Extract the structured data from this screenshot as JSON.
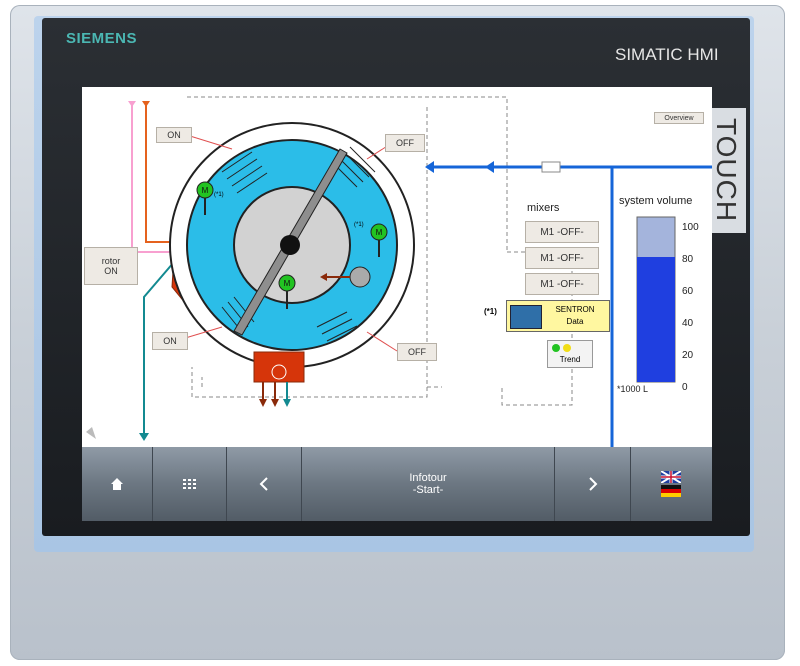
{
  "device": {
    "brand": "SIEMENS",
    "model": "SIMATIC HMI",
    "side_label": "TOUCH"
  },
  "screen": {
    "overview_button": "Overview",
    "labels": {
      "on_top": "ON",
      "off_top": "OFF",
      "on_bottom": "ON",
      "off_bottom": "OFF",
      "rotor_line1": "rotor",
      "rotor_line2": "ON"
    },
    "motor_glyph": "M",
    "footnote_top": "(*1)",
    "footnote_right": "(*1)",
    "mixers": {
      "title": "mixers",
      "items": [
        "M1 -OFF-",
        "M1 -OFF-",
        "M1 -OFF-"
      ]
    },
    "sentron": {
      "marker": "(*1)",
      "line1": "SENTRON",
      "line2": "Data"
    },
    "trend": "Trend",
    "volume": {
      "title": "system volume",
      "unit_note": "*1000 L",
      "ticks": [
        "100",
        "80",
        "60",
        "40",
        "20",
        "0"
      ],
      "level_fraction": 0.76
    }
  },
  "taskbar": {
    "infotour_line1": "Infotour",
    "infotour_line2": "-Start-"
  },
  "colors": {
    "screen_bg": "#ffffff",
    "tank_blue": "#1f3fe0",
    "tank_empty": "#a4b4dc",
    "drum_cyan": "#2bbde8",
    "flow_blue": "#1565d8",
    "heater_red": "#d6350a",
    "motor_green": "#22c322",
    "taskbar_gray": "#6c7782"
  }
}
